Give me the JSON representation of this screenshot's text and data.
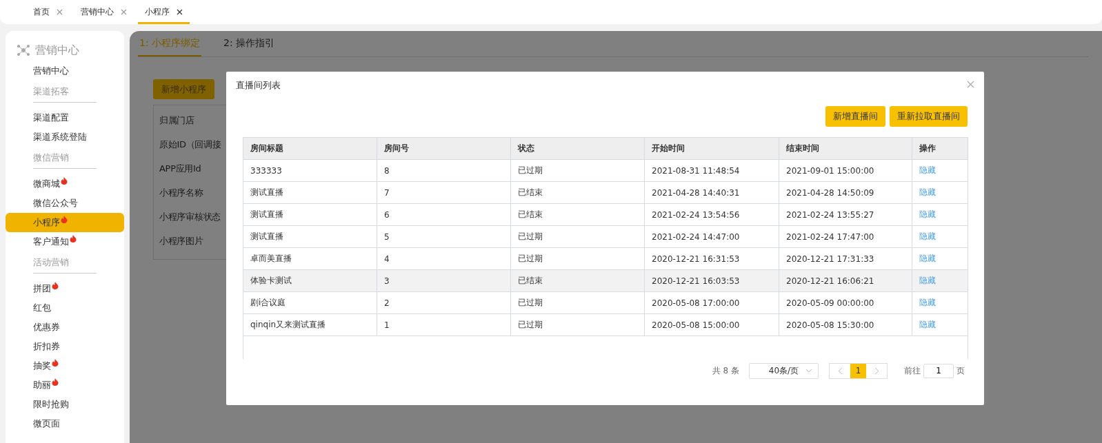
{
  "top_tabs": [
    {
      "label": "首页",
      "selected": false
    },
    {
      "label": "营销中心",
      "selected": false
    },
    {
      "label": "小程序",
      "selected": true
    }
  ],
  "sidebar": {
    "title": "营销中心",
    "entries": [
      {
        "kind": "item",
        "label": "营销中心",
        "selected": false,
        "hot": false
      },
      {
        "kind": "section",
        "label": "渠道拓客"
      },
      {
        "kind": "item",
        "label": "渠道配置",
        "selected": false,
        "hot": false
      },
      {
        "kind": "item",
        "label": "渠道系统登陆",
        "selected": false,
        "hot": false
      },
      {
        "kind": "section",
        "label": "微信营销"
      },
      {
        "kind": "item",
        "label": "微商城",
        "selected": false,
        "hot": true
      },
      {
        "kind": "item",
        "label": "微信公众号",
        "selected": false,
        "hot": false
      },
      {
        "kind": "item",
        "label": "小程序",
        "selected": true,
        "hot": true
      },
      {
        "kind": "item",
        "label": "客户通知",
        "selected": false,
        "hot": true
      },
      {
        "kind": "section",
        "label": "活动营销"
      },
      {
        "kind": "item",
        "label": "拼团",
        "selected": false,
        "hot": true
      },
      {
        "kind": "item",
        "label": "红包",
        "selected": false,
        "hot": false
      },
      {
        "kind": "item",
        "label": "优惠券",
        "selected": false,
        "hot": false
      },
      {
        "kind": "item",
        "label": "折扣券",
        "selected": false,
        "hot": false
      },
      {
        "kind": "item",
        "label": "抽奖",
        "selected": false,
        "hot": true
      },
      {
        "kind": "item",
        "label": "助丽",
        "selected": false,
        "hot": true
      },
      {
        "kind": "item",
        "label": "限时抢购",
        "selected": false,
        "hot": false
      },
      {
        "kind": "item",
        "label": "微页面",
        "selected": false,
        "hot": false
      }
    ]
  },
  "main": {
    "tabs": [
      {
        "label": "1: 小程序绑定",
        "selected": true
      },
      {
        "label": "2: 操作指引",
        "selected": false
      }
    ],
    "add_button": "新增小程序",
    "form_labels": [
      "归属门店",
      "原始ID（回调接",
      "APP应用Id",
      "小程序名称",
      "小程序审核状态",
      "小程序图片"
    ]
  },
  "dialog": {
    "title": "直播间列表",
    "buttons": [
      "新增直播间",
      "重新拉取直播间"
    ],
    "table": {
      "columns": [
        "房间标题",
        "房间号",
        "状态",
        "开始时间",
        "结束时间",
        "操作"
      ],
      "rows": [
        {
          "cells": [
            "333333",
            "8",
            "已过期",
            "2021-08-31 11:48:54",
            "2021-09-01 15:00:00"
          ],
          "action": "隐藏",
          "selected": false
        },
        {
          "cells": [
            "测试直播",
            "7",
            "已结束",
            "2021-04-28 14:40:31",
            "2021-04-28 14:50:09"
          ],
          "action": "隐藏",
          "selected": false
        },
        {
          "cells": [
            "测试直播",
            "6",
            "已结束",
            "2021-02-24 13:54:56",
            "2021-02-24 13:55:27"
          ],
          "action": "隐藏",
          "selected": false
        },
        {
          "cells": [
            "测试直播",
            "5",
            "已过期",
            "2021-02-24 14:47:00",
            "2021-02-24 17:47:00"
          ],
          "action": "隐藏",
          "selected": false
        },
        {
          "cells": [
            "卓而美直播",
            "4",
            "已过期",
            "2020-12-21 16:31:53",
            "2020-12-21 17:31:33"
          ],
          "action": "隐藏",
          "selected": false
        },
        {
          "cells": [
            "体验卡测试",
            "3",
            "已结束",
            "2020-12-21 16:03:53",
            "2020-12-21 16:06:21"
          ],
          "action": "隐藏",
          "selected": true
        },
        {
          "cells": [
            "剧i合议庭",
            "2",
            "已过期",
            "2020-05-08 17:00:00",
            "2020-05-09 00:00:00"
          ],
          "action": "隐藏",
          "selected": false
        },
        {
          "cells": [
            "qinqin又来测试直播",
            "1",
            "已过期",
            "2020-05-08 15:00:00",
            "2020-05-08 15:30:00"
          ],
          "action": "隐藏",
          "selected": false
        }
      ]
    },
    "pagination": {
      "total": "共 8 条",
      "page_size": "40条/页",
      "pages": [
        {
          "label": "1",
          "selected": true
        }
      ],
      "goto_label": "前往",
      "goto_value": "1",
      "page_unit": "页"
    }
  }
}
